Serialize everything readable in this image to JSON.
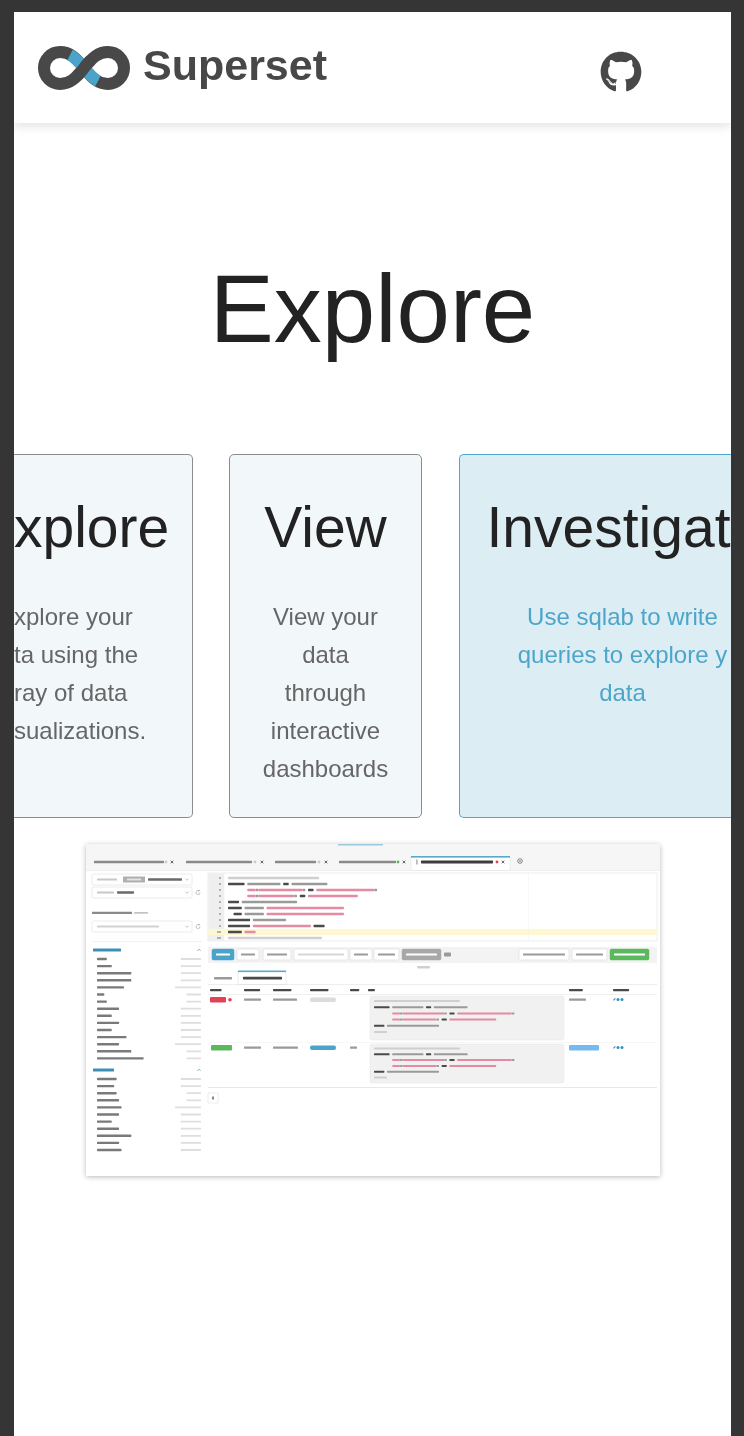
{
  "header": {
    "brand": "Superset"
  },
  "heading": "Explore",
  "cards": [
    {
      "title": "xplore",
      "description": "xplore your\nta using the\nray of data\nsualizations.",
      "selected": false
    },
    {
      "title": "View",
      "description": "View your data through interactive dashboards",
      "selected": false
    },
    {
      "title": "Investigat",
      "description": "Use sqlab to write\nqueries to explore y\ndata",
      "selected": true
    }
  ]
}
